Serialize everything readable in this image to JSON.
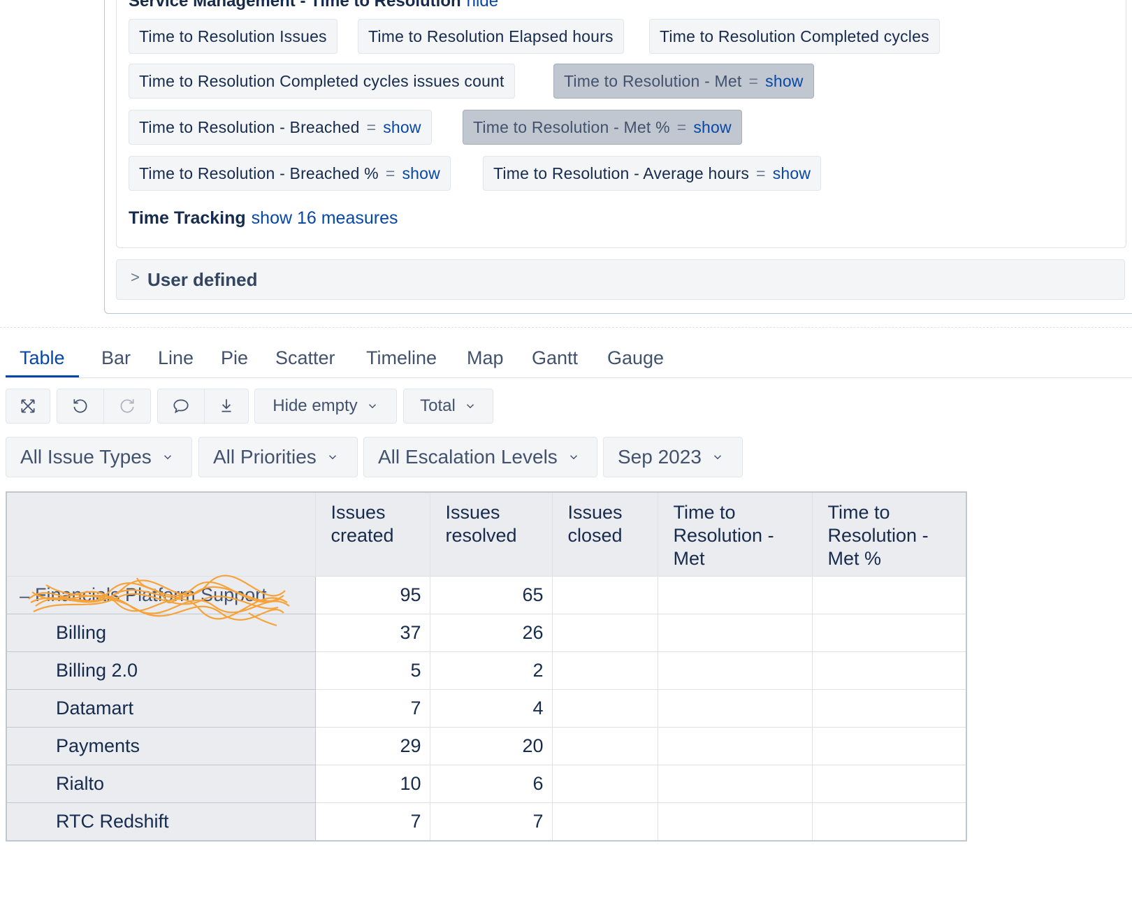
{
  "measures_panel": {
    "section_title": "Service Management - Time to Resolution",
    "section_hide_link": "hide",
    "chips": [
      {
        "label": "Time to Resolution Issues",
        "show": "",
        "selected": false
      },
      {
        "label": "Time to Resolution Elapsed hours",
        "show": "",
        "selected": false
      },
      {
        "label": "Time to Resolution Completed cycles",
        "show": "",
        "selected": false
      },
      {
        "label": "Time to Resolution Completed cycles issues count",
        "show": "",
        "selected": false
      },
      {
        "label": "Time to Resolution - Met",
        "show": "show",
        "selected": true
      },
      {
        "label": "Time to Resolution - Breached",
        "show": "show",
        "selected": false
      },
      {
        "label": "Time to Resolution - Met %",
        "show": "show",
        "selected": true
      },
      {
        "label": "Time to Resolution - Breached %",
        "show": "show",
        "selected": false
      },
      {
        "label": "Time to Resolution - Average hours",
        "show": "show",
        "selected": false
      }
    ],
    "eq_symbol": "=",
    "time_tracking_label": "Time Tracking",
    "time_tracking_link": "show 16 measures",
    "user_defined_label": "User defined",
    "user_defined_chevron": ">"
  },
  "tabs": [
    "Table",
    "Bar",
    "Line",
    "Pie",
    "Scatter",
    "Timeline",
    "Map",
    "Gantt",
    "Gauge"
  ],
  "active_tab": "Table",
  "toolbar": {
    "hide_empty_label": "Hide empty",
    "total_label": "Total",
    "icons": [
      "full-width-icon",
      "undo-icon",
      "redo-icon",
      "comment-icon",
      "export-icon"
    ]
  },
  "filters": [
    "All Issue Types",
    "All Priorities",
    "All Escalation Levels",
    "Sep 2023"
  ],
  "table": {
    "columns": [
      "Issues created",
      "Issues resolved",
      "Issues closed",
      "Time to Resolution - Met",
      "Time to Resolution - Met %"
    ],
    "top_row": {
      "label": "Financials Platform Support",
      "collapse_symbol": "–",
      "values": [
        "95",
        "65",
        "",
        "",
        ""
      ]
    },
    "rows": [
      {
        "label": "Billing",
        "values": [
          "37",
          "26",
          "",
          "",
          ""
        ]
      },
      {
        "label": "Billing 2.0",
        "values": [
          "5",
          "2",
          "",
          "",
          ""
        ]
      },
      {
        "label": "Datamart",
        "values": [
          "7",
          "4",
          "",
          "",
          ""
        ]
      },
      {
        "label": "Payments",
        "values": [
          "29",
          "20",
          "",
          "",
          ""
        ]
      },
      {
        "label": "Rialto",
        "values": [
          "10",
          "6",
          "",
          "",
          ""
        ]
      },
      {
        "label": "RTC Redshift",
        "values": [
          "7",
          "7",
          "",
          "",
          ""
        ]
      }
    ]
  },
  "colors": {
    "link": "#0747a6",
    "chip_bg": "#f4f5f7",
    "chip_selected": "#c1c7d0",
    "scribble": "#f5a33a"
  }
}
